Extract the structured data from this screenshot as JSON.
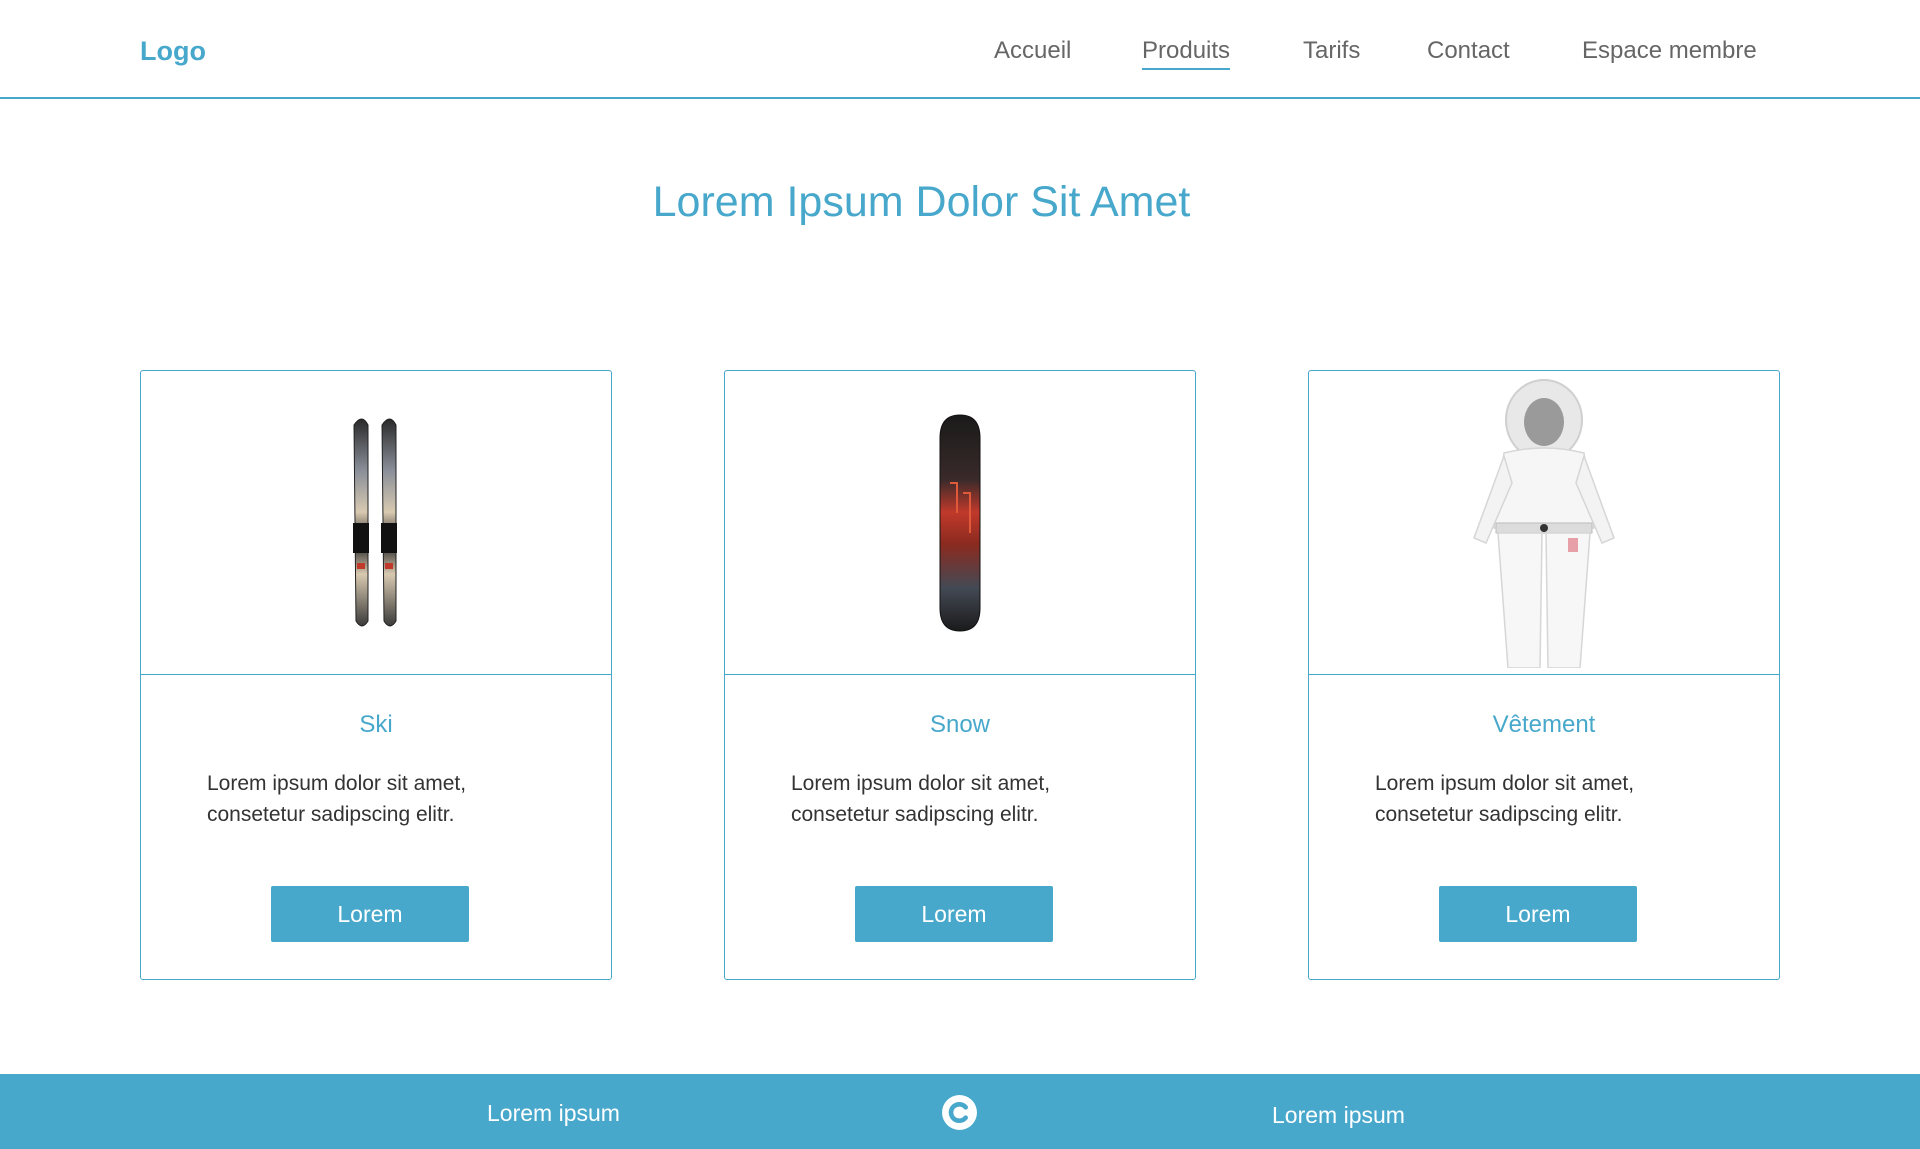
{
  "header": {
    "logo": "Logo",
    "nav": [
      {
        "label": "Accueil",
        "active": false
      },
      {
        "label": "Produits",
        "active": true
      },
      {
        "label": "Tarifs",
        "active": false
      },
      {
        "label": "Contact",
        "active": false
      },
      {
        "label": "Espace membre",
        "active": false
      }
    ]
  },
  "main": {
    "title": "Lorem Ipsum Dolor Sit Amet",
    "cards": [
      {
        "image_icon": "skis-icon",
        "title": "Ski",
        "text": "Lorem ipsum dolor sit amet, consetetur sadipscing elitr.",
        "button": "Lorem"
      },
      {
        "image_icon": "snowboard-icon",
        "title": "Snow",
        "text": "Lorem ipsum dolor sit amet, consetetur sadipscing elitr.",
        "button": "Lorem"
      },
      {
        "image_icon": "ski-suit-icon",
        "title": "Vêtement",
        "text": "Lorem ipsum dolor sit amet, consetetur sadipscing elitr.",
        "button": "Lorem"
      }
    ]
  },
  "footer": {
    "left_link": "Lorem ipsum",
    "center_icon": "copyright-icon",
    "right_link": "Lorem ipsum"
  },
  "colors": {
    "accent": "#47a8cc",
    "text": "#333333",
    "nav_text": "#666666",
    "background": "#ffffff"
  }
}
